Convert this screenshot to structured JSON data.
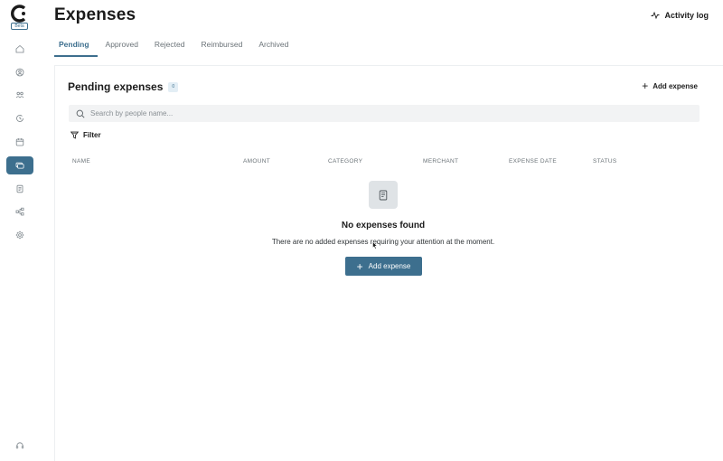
{
  "app": {
    "logo_letter": "C",
    "beta_label": "Beta"
  },
  "sidebar": {
    "items": [
      {
        "name": "home",
        "icon": "home-icon",
        "active": false
      },
      {
        "name": "people",
        "icon": "person-circle-icon",
        "active": false
      },
      {
        "name": "teams",
        "icon": "users-icon",
        "active": false
      },
      {
        "name": "time-off",
        "icon": "clock-refresh-icon",
        "active": false
      },
      {
        "name": "calendar",
        "icon": "calendar-icon",
        "active": false
      },
      {
        "name": "expenses",
        "icon": "expenses-icon",
        "active": true
      },
      {
        "name": "documents",
        "icon": "document-icon",
        "active": false
      },
      {
        "name": "workflows",
        "icon": "workflow-icon",
        "active": false
      },
      {
        "name": "settings",
        "icon": "gear-icon",
        "active": false
      }
    ],
    "support_icon": "headset-icon"
  },
  "header": {
    "title": "Expenses",
    "activity_log_label": "Activity log"
  },
  "tabs": [
    {
      "label": "Pending",
      "active": true
    },
    {
      "label": "Approved",
      "active": false
    },
    {
      "label": "Rejected",
      "active": false
    },
    {
      "label": "Reimbursed",
      "active": false
    },
    {
      "label": "Archived",
      "active": false
    }
  ],
  "section": {
    "title": "Pending expenses",
    "count": "0",
    "add_label": "Add expense"
  },
  "search": {
    "placeholder": "Search by people name...",
    "value": ""
  },
  "filter": {
    "label": "Filter"
  },
  "table": {
    "columns": [
      "NAME",
      "AMOUNT",
      "CATEGORY",
      "MERCHANT",
      "EXPENSE DATE",
      "STATUS"
    ]
  },
  "empty_state": {
    "title": "No expenses found",
    "subtitle": "There are no added expenses requiring your attention at the moment.",
    "button_label": "Add expense"
  },
  "colors": {
    "accent": "#3d6f8e",
    "badge_bg": "#e3eef5",
    "search_bg": "#f2f3f4"
  }
}
